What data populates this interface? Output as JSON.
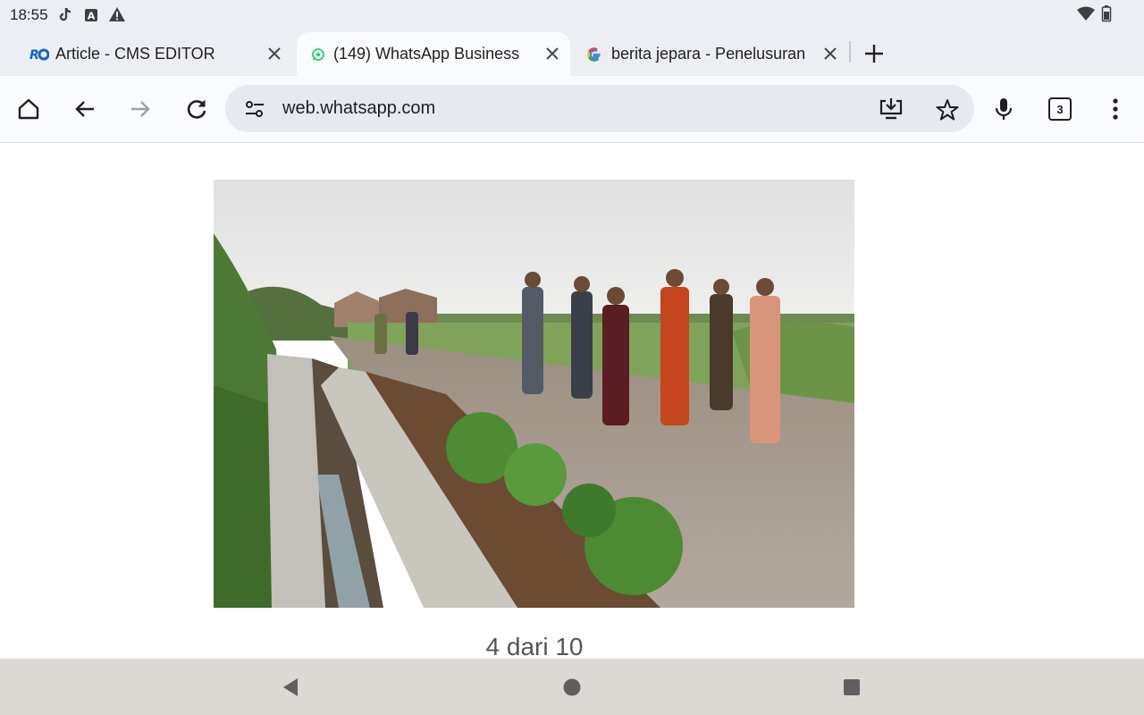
{
  "status_bar": {
    "time": "18:55",
    "left_icons": [
      "tiktok-icon",
      "text-a-icon",
      "warning-icon"
    ],
    "right_icons": [
      "wifi-icon",
      "battery-icon"
    ]
  },
  "tabs": [
    {
      "title": "Article - CMS EDITOR",
      "favicon": "ro-logo-icon",
      "active": false
    },
    {
      "title": "(149) WhatsApp Business",
      "favicon": "whatsapp-icon",
      "active": true
    },
    {
      "title": "berita jepara - Penelusuran",
      "favicon": "google-icon",
      "active": false
    }
  ],
  "toolbar": {
    "url": "web.whatsapp.com",
    "tab_count": "3"
  },
  "content": {
    "counter": "4 dari 10"
  },
  "colors": {
    "chrome_bg": "#eceef4",
    "active_tab_bg": "#fafbff",
    "omnibox_bg": "#e7e9f1",
    "nav_bar_bg": "#dcd9d5",
    "whatsapp_green": "#25d366"
  }
}
